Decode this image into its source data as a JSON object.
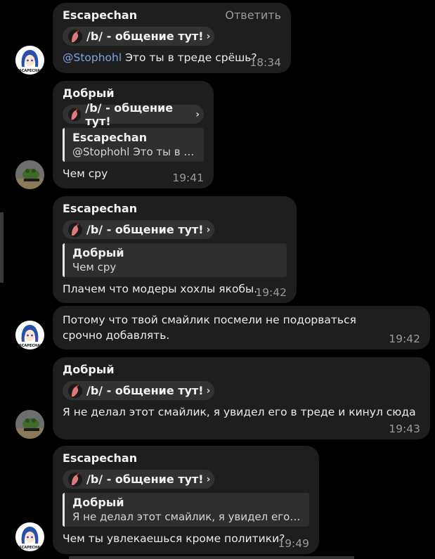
{
  "messages": [
    {
      "sender": "Escapechan",
      "action": "Ответить",
      "topic": "/b/ - общение тут!",
      "mention": "@Stophohl",
      "text": " Это ты в треде срёшь?",
      "time": "18:34"
    },
    {
      "sender": "Добрый",
      "topic": "/b/ - общение тут!",
      "quote_author": "Escapechan",
      "quote_text": "@Stophohl Это ты в т...",
      "text": "Чем сру",
      "time": "19:41"
    },
    {
      "sender": "Escapechan",
      "topic": "/b/ - общение тут!",
      "quote_author": "Добрый",
      "quote_text": "Чем сру",
      "text": "Плачем что модеры хохлы якобы.",
      "time": "19:42"
    },
    {
      "text": "Потому что твой смайлик посмели не подорваться срочно добавлять.",
      "time": "19:42"
    },
    {
      "sender": "Добрый",
      "topic": "/b/ - общение тут!",
      "text": "Я не делал этот смайлик, я увидел его в треде и кинул сюда",
      "time": "19:43"
    },
    {
      "sender": "Escapechan",
      "topic": "/b/ - общение тут!",
      "quote_author": "Добрый",
      "quote_text": "Я не делал этот смайлик, я увидел его в т...",
      "text": "Чем ты увлекаешься кроме политики?",
      "time": "19:49"
    }
  ],
  "avatar_labels": {
    "escapechan": "ESCAPECHAN"
  },
  "icons": {
    "topic": "rooster-icon",
    "chevron": "chevron-right-icon"
  },
  "colors": {
    "background": "#000000",
    "bubble": "#1e1e1e",
    "mention": "#7ea6e0",
    "time": "#9a9a9a"
  }
}
